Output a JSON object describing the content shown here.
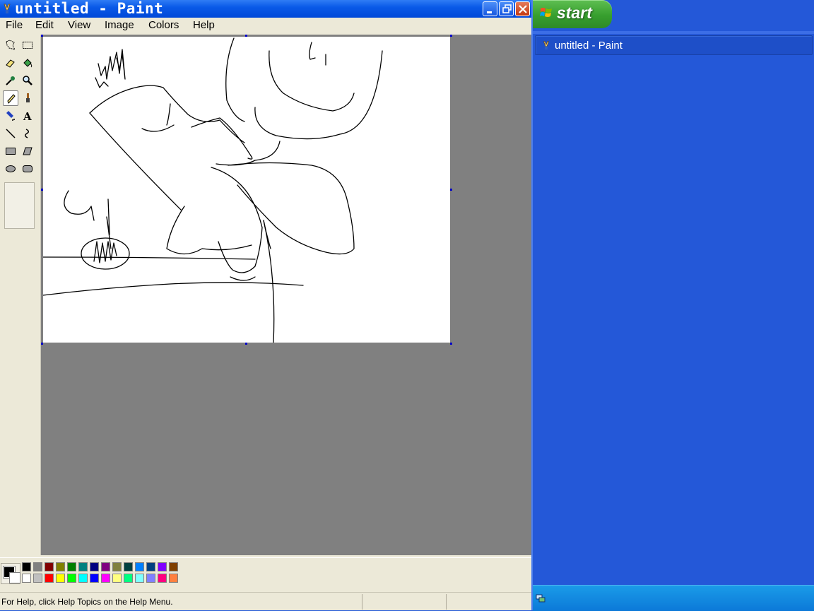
{
  "window": {
    "title": "untitled - Paint",
    "controls": [
      "minimize-icon",
      "restore-icon",
      "close-icon"
    ]
  },
  "menu": {
    "items": [
      "File",
      "Edit",
      "View",
      "Image",
      "Colors",
      "Help"
    ]
  },
  "toolbox": {
    "tools": [
      "free-form-select-icon",
      "select-icon",
      "eraser-icon",
      "fill-icon",
      "pick-color-icon",
      "magnifier-icon",
      "pencil-icon",
      "brush-icon",
      "airbrush-icon",
      "text-icon",
      "line-icon",
      "curve-icon",
      "rectangle-icon",
      "polygon-icon",
      "ellipse-icon",
      "rounded-rectangle-icon"
    ],
    "selected": "pencil-icon"
  },
  "palette": {
    "foreground": "#000000",
    "background": "#ffffff",
    "top_row": [
      "#000000",
      "#808080",
      "#800000",
      "#808000",
      "#008000",
      "#008080",
      "#000080",
      "#800080",
      "#808040",
      "#004040",
      "#0080ff",
      "#004080",
      "#8000ff",
      "#804000"
    ],
    "bottom_row": [
      "#ffffff",
      "#c0c0c0",
      "#ff0000",
      "#ffff00",
      "#00ff00",
      "#00ffff",
      "#0000ff",
      "#ff00ff",
      "#ffff80",
      "#00ff80",
      "#80ffff",
      "#8080ff",
      "#ff0080",
      "#ff8040"
    ]
  },
  "status": {
    "help_text": "For Help, click Help Topics on the Help Menu."
  },
  "taskbar": {
    "start_label": "start",
    "task_label": "untitled - Paint"
  }
}
